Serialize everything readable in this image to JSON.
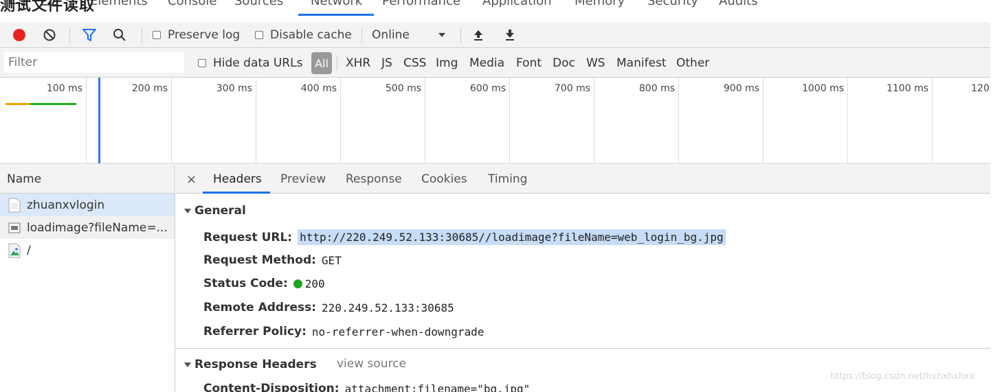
{
  "overlay_title": "测试文件读取",
  "top_tabs": [
    "Elements",
    "Console",
    "Sources",
    "Network",
    "Performance",
    "Application",
    "Memory",
    "Security",
    "Audits"
  ],
  "toolbar": {
    "preserve_log": "Preserve log",
    "disable_cache": "Disable cache",
    "throttling": "Online"
  },
  "filter": {
    "placeholder": "Filter",
    "hide_data_urls": "Hide data URLs",
    "types": [
      "All",
      "XHR",
      "JS",
      "CSS",
      "Img",
      "Media",
      "Font",
      "Doc",
      "WS",
      "Manifest",
      "Other"
    ],
    "active_type": "All"
  },
  "timeline": {
    "ticks": [
      "100 ms",
      "200 ms",
      "300 ms",
      "400 ms",
      "500 ms",
      "600 ms",
      "700 ms",
      "800 ms",
      "900 ms",
      "1000 ms",
      "1100 ms",
      "120"
    ]
  },
  "requests": {
    "header": "Name",
    "items": [
      {
        "name": "zhuanxvlogin",
        "icon": "document-icon"
      },
      {
        "name": "loadimage?fileName=...",
        "icon": "image-file-icon"
      },
      {
        "name": "/",
        "icon": "image-file-icon"
      }
    ]
  },
  "detail": {
    "close": "×",
    "tabs": [
      "Headers",
      "Preview",
      "Response",
      "Cookies",
      "Timing"
    ],
    "active_tab": "Headers",
    "general": {
      "title": "General",
      "request_url_key": "Request URL:",
      "request_url": "http://220.249.52.133:30685//loadimage?fileName=web_login_bg.jpg",
      "request_method_key": "Request Method:",
      "request_method": "GET",
      "status_code_key": "Status Code:",
      "status_code": "200",
      "remote_address_key": "Remote Address:",
      "remote_address": "220.249.52.133:30685",
      "referrer_policy_key": "Referrer Policy:",
      "referrer_policy": "no-referrer-when-downgrade"
    },
    "response_headers": {
      "title": "Response Headers",
      "view_source": "view source",
      "first_key": "Content-Disposition:",
      "first_value": "attachment;filename=\"bg.jpg\""
    }
  },
  "watermark": "https://blog.csdn.net/hxhxhxhxx",
  "colors": {
    "record": "#e8231f",
    "filter_active": "#1a73e8",
    "selection": "#dbe8f9",
    "status_ok": "#1fa61f",
    "dom_content_loaded": "#3b78e7"
  }
}
